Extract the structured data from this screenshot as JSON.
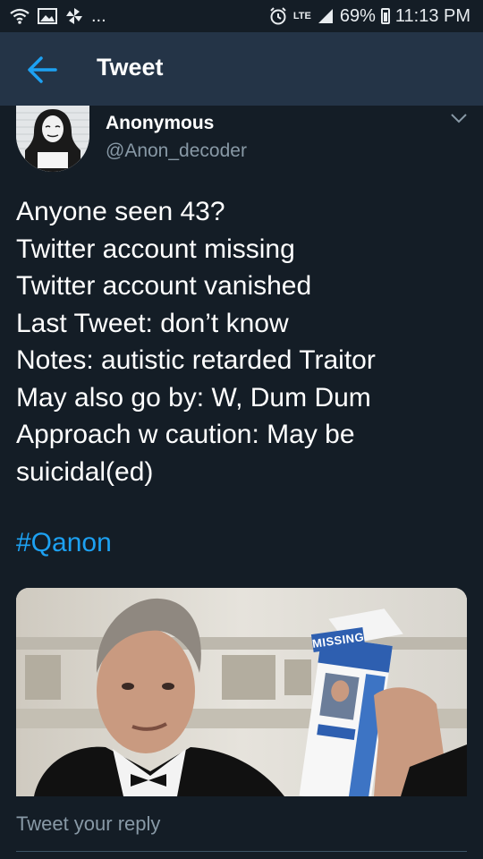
{
  "status_bar": {
    "network": "LTE",
    "battery": "69%",
    "time": "11:13 PM",
    "more_indicator": "...",
    "icons": [
      "wifi-icon",
      "image-icon",
      "pinwheel-icon",
      "alarm-icon",
      "signal-icon",
      "battery-icon"
    ]
  },
  "header": {
    "title": "Tweet",
    "back_icon": "arrow-left-icon",
    "accent_color": "#1da1f2"
  },
  "tweet": {
    "author_name": "Anonymous",
    "author_handle": "@Anon_decoder",
    "lines": [
      "Anyone seen 43?",
      "Twitter account missing",
      "Twitter account vanished",
      "Last Tweet: don’t know",
      "Notes: autistic retarded Traitor",
      "May also go by: W, Dum Dum",
      "Approach w caution: May be",
      "suicidal(ed)"
    ],
    "hashtag": "#Qanon",
    "media_text": "MISSING"
  },
  "reply": {
    "placeholder": "Tweet your reply"
  },
  "colors": {
    "background": "#141d26",
    "header_background": "#243447",
    "secondary_text": "#8899a6",
    "link": "#1da1f2"
  }
}
